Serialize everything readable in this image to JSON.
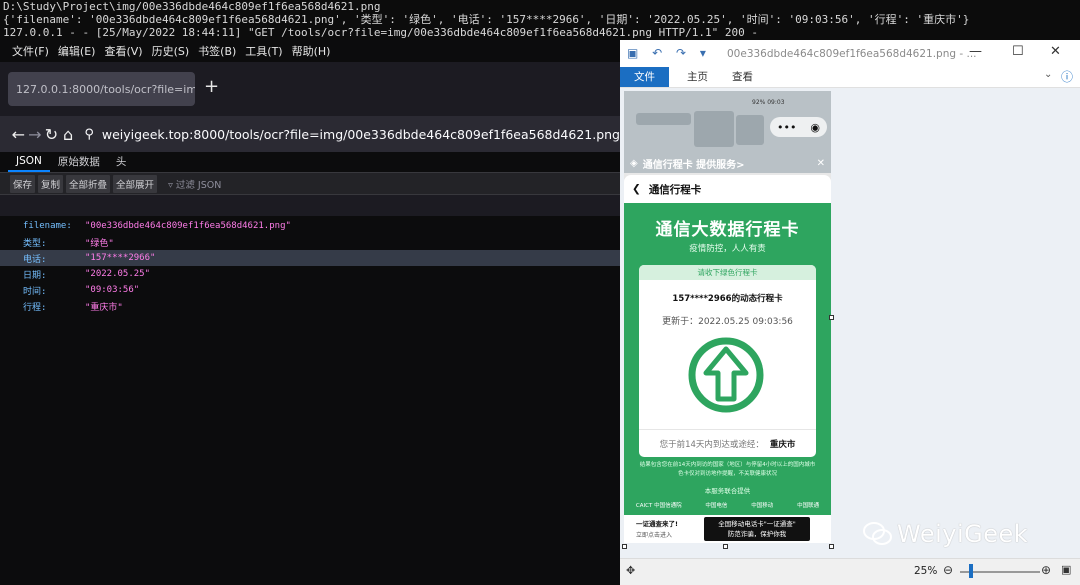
{
  "terminal": {
    "lines": [
      "D:\\Study\\Project\\img/00e336dbde464c809ef1f6ea568d4621.png",
      "{'filename': '00e336dbde464c809ef1f6ea568d4621.png', '类型': '绿色', '电话': '157****2966', '日期': '2022.05.25', '时间': '09:03:56', '行程': '重庆市'}",
      "127.0.0.1 - - [25/May/2022 18:44:11] \"GET /tools/ocr?file=img/00e336dbde464c809ef1f6ea568d4621.png HTTP/1.1\" 200 -"
    ]
  },
  "browser": {
    "menu": [
      "文件(F)",
      "编辑(E)",
      "查看(V)",
      "历史(S)",
      "书签(B)",
      "工具(T)",
      "帮助(H)"
    ],
    "tab_title": "127.0.0.1:8000/tools/ocr?file=im",
    "new_tab": "+",
    "url": "weiyigeek.top:8000/tools/ocr?file=img/00e336dbde464c809ef1f6ea568d4621.png",
    "viewer_tabs": [
      "JSON",
      "原始数据",
      "头"
    ],
    "toolbar": [
      "保存",
      "复制",
      "全部折叠",
      "全部展开"
    ],
    "filter_placeholder": "过滤 JSON",
    "rows": [
      {
        "key": "filename:",
        "value": "\"00e336dbde464c809ef1f6ea568d4621.png\""
      },
      {
        "key": "类型:",
        "value": "\"绿色\""
      },
      {
        "key": "电话:",
        "value": "\"157****2966\""
      },
      {
        "key": "日期:",
        "value": "\"2022.05.25\""
      },
      {
        "key": "时间:",
        "value": "\"09:03:56\""
      },
      {
        "key": "行程:",
        "value": "\"重庆市\""
      }
    ]
  },
  "viewer": {
    "title": "00e336dbde464c809ef1f6ea568d4621.png - ...",
    "ribbon_tabs": [
      "文件",
      "主页",
      "查看"
    ],
    "zoom": "25%",
    "phone": {
      "status": "92% 09:03",
      "service_bar": "通信行程卡 提供服务>",
      "page_title": "通信行程卡",
      "big_title": "通信大数据行程卡",
      "subtitle": "疫情防控，人人有责",
      "inner_head": "请收下绿色行程卡",
      "phone_line": "157****2966的动态行程卡",
      "updated": "更新于：2022.05.25 09:03:56",
      "visited_label": "您于前14天内到达或途经：",
      "visited_city": "重庆市",
      "fine_print_1": "结果包含您在前14天内到访的国家（地区）与停留4小时以上的国内城市",
      "fine_print_2": "色卡仅对到访地作提醒，不关联健康状况",
      "provider_label": "本服务联合提供",
      "logos": [
        "CAICT 中国信通院",
        "中国电信",
        "中国移动",
        "中国联通"
      ],
      "bottom_left_1": "一证通查来了!",
      "bottom_left_2": "立即点击进入",
      "bottom_btn_1": "全国移动电话卡\"一证通查\"",
      "bottom_btn_2": "防范诈骗，保护你我"
    },
    "watermark": "WeiyiGeek"
  }
}
